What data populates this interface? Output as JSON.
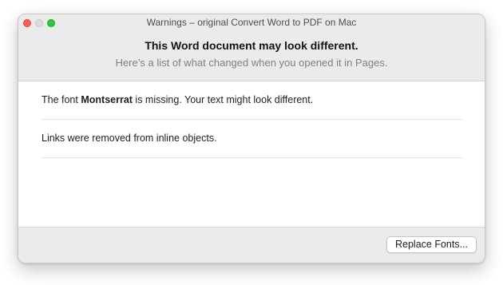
{
  "window": {
    "title": "Warnings – original Convert Word to PDF on Mac"
  },
  "header": {
    "title": "This Word document may look different.",
    "subtitle": "Here’s a list of what changed when you opened it in Pages."
  },
  "warnings": [
    {
      "prefix": "The font ",
      "emphasis": "Montserrat",
      "suffix": " is missing. Your text might look different."
    },
    {
      "text": "Links were removed from inline objects."
    }
  ],
  "footer": {
    "replace_fonts_label": "Replace Fonts..."
  },
  "colors": {
    "close_button": "#fe5f57",
    "minimize_button": "#dcdcdc",
    "zoom_button": "#28c840",
    "header_background": "#ebebeb"
  }
}
